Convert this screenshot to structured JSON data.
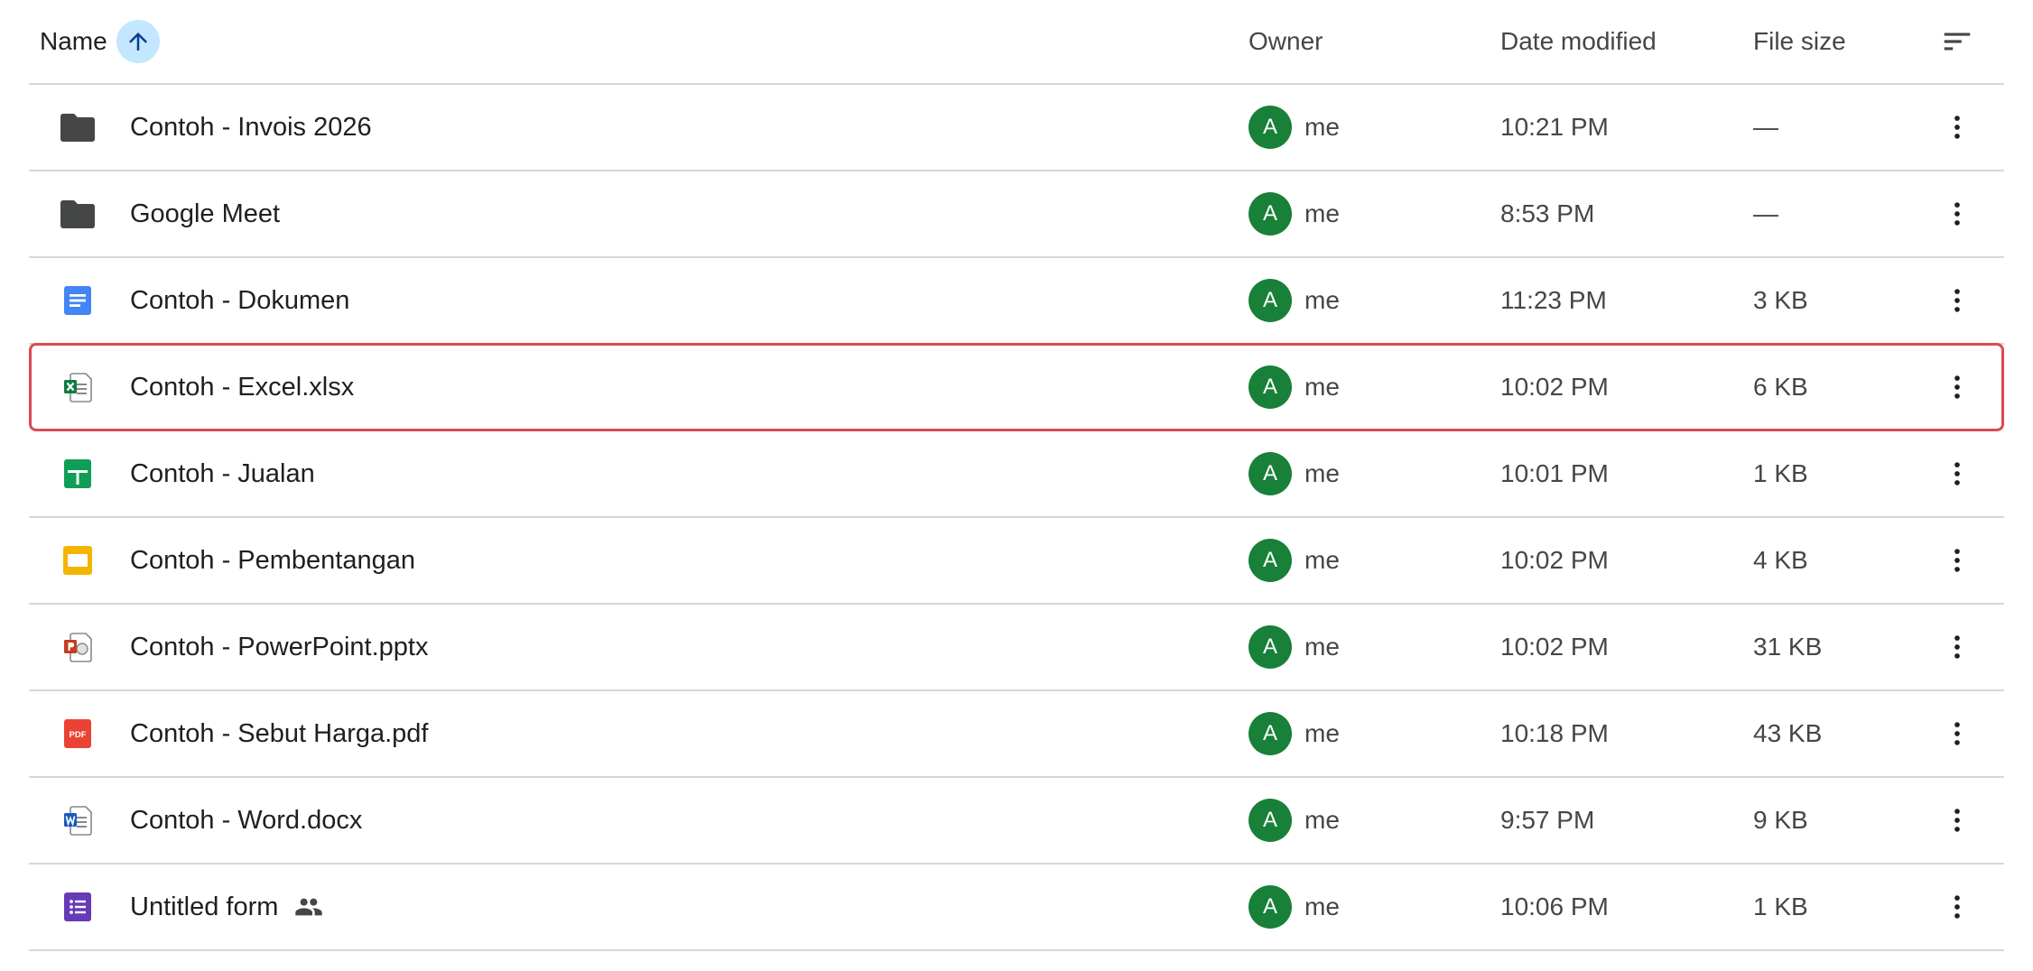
{
  "header": {
    "name_label": "Name",
    "owner_label": "Owner",
    "date_label": "Date modified",
    "size_label": "File size",
    "sort_direction": "ascending"
  },
  "rows": [
    {
      "icon": "folder-icon",
      "name": "Contoh - Invois 2026",
      "owner_initial": "A",
      "owner": "me",
      "date": "10:21 PM",
      "size": "—",
      "selected": false,
      "shared": false
    },
    {
      "icon": "folder-icon",
      "name": "Google Meet",
      "owner_initial": "A",
      "owner": "me",
      "date": "8:53 PM",
      "size": "—",
      "selected": false,
      "shared": false
    },
    {
      "icon": "google-docs-icon",
      "name": "Contoh - Dokumen",
      "owner_initial": "A",
      "owner": "me",
      "date": "11:23 PM",
      "size": "3 KB",
      "selected": false,
      "shared": false
    },
    {
      "icon": "excel-file-icon",
      "name": "Contoh - Excel.xlsx",
      "owner_initial": "A",
      "owner": "me",
      "date": "10:02 PM",
      "size": "6 KB",
      "selected": true,
      "shared": false
    },
    {
      "icon": "google-sheets-icon",
      "name": "Contoh - Jualan",
      "owner_initial": "A",
      "owner": "me",
      "date": "10:01 PM",
      "size": "1 KB",
      "selected": false,
      "shared": false
    },
    {
      "icon": "google-slides-icon",
      "name": "Contoh - Pembentangan",
      "owner_initial": "A",
      "owner": "me",
      "date": "10:02 PM",
      "size": "4 KB",
      "selected": false,
      "shared": false
    },
    {
      "icon": "powerpoint-file-icon",
      "name": "Contoh - PowerPoint.pptx",
      "owner_initial": "A",
      "owner": "me",
      "date": "10:02 PM",
      "size": "31 KB",
      "selected": false,
      "shared": false
    },
    {
      "icon": "pdf-file-icon",
      "name": "Contoh - Sebut Harga.pdf",
      "owner_initial": "A",
      "owner": "me",
      "date": "10:18 PM",
      "size": "43 KB",
      "selected": false,
      "shared": false
    },
    {
      "icon": "word-file-icon",
      "name": "Contoh - Word.docx",
      "owner_initial": "A",
      "owner": "me",
      "date": "9:57 PM",
      "size": "9 KB",
      "selected": false,
      "shared": false
    },
    {
      "icon": "google-forms-icon",
      "name": "Untitled form",
      "owner_initial": "A",
      "owner": "me",
      "date": "10:06 PM",
      "size": "1 KB",
      "selected": false,
      "shared": true
    }
  ],
  "colors": {
    "avatar": "#188038",
    "selection_outline": "#dc4a53",
    "sort_button_bg": "#c2e7ff"
  }
}
